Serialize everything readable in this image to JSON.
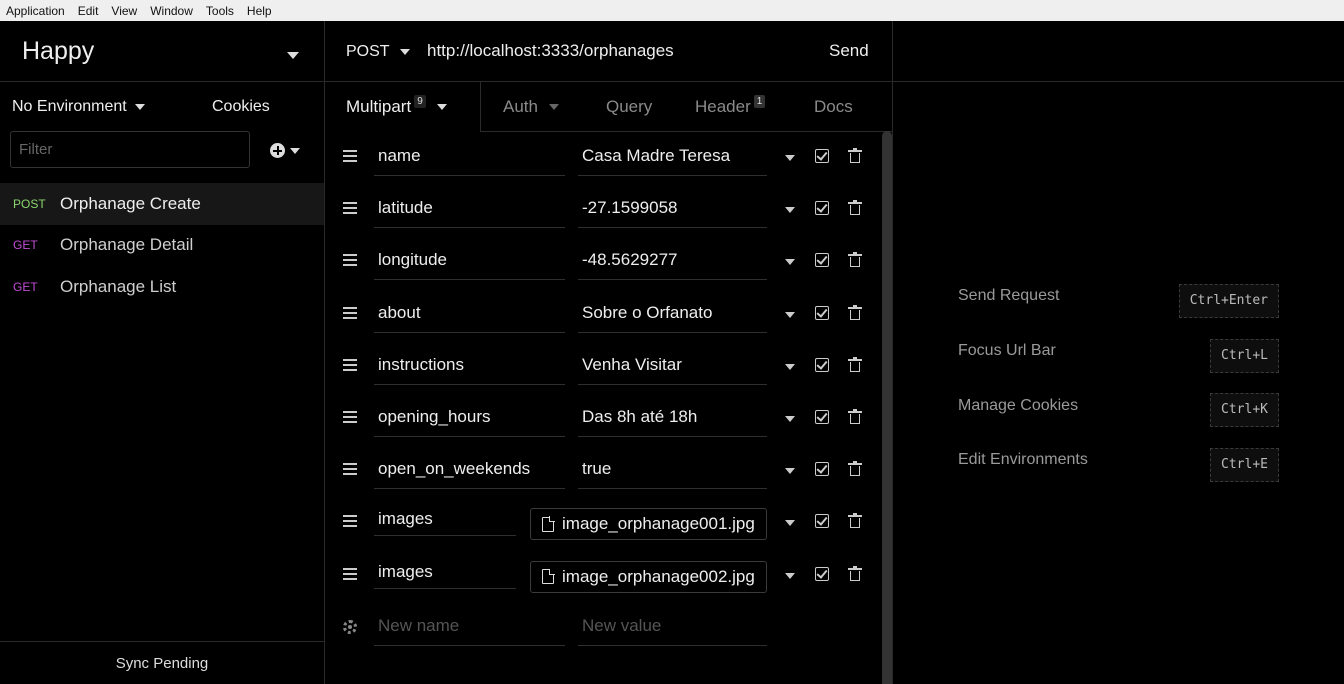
{
  "menu": [
    "Application",
    "Edit",
    "View",
    "Window",
    "Tools",
    "Help"
  ],
  "sidebar": {
    "workspace": "Happy",
    "environment": "No Environment",
    "cookies": "Cookies",
    "filter_placeholder": "Filter",
    "requests": [
      {
        "method": "POST",
        "name": "Orphanage Create"
      },
      {
        "method": "GET",
        "name": "Orphanage Detail"
      },
      {
        "method": "GET",
        "name": "Orphanage List"
      }
    ],
    "sync": "Sync Pending"
  },
  "request": {
    "method": "POST",
    "url": "http://localhost:3333/orphanages",
    "send": "Send",
    "tabs": [
      {
        "label": "Multipart",
        "badge": "9"
      },
      {
        "label": "Auth"
      },
      {
        "label": "Query"
      },
      {
        "label": "Header",
        "badge": "1"
      },
      {
        "label": "Docs"
      }
    ],
    "fields": [
      {
        "name": "name",
        "value": "Casa Madre Teresa"
      },
      {
        "name": "latitude",
        "value": "-27.1599058"
      },
      {
        "name": "longitude",
        "value": "-48.5629277"
      },
      {
        "name": "about",
        "value": "Sobre o Orfanato"
      },
      {
        "name": "instructions",
        "value": "Venha Visitar"
      },
      {
        "name": "opening_hours",
        "value": "Das 8h até 18h"
      },
      {
        "name": "open_on_weekends",
        "value": "true"
      },
      {
        "name": "images",
        "file": "image_orphanage001.jpg"
      },
      {
        "name": "images",
        "file": "image_orphanage002.jpg"
      }
    ],
    "new_name_placeholder": "New name",
    "new_value_placeholder": "New value"
  },
  "response": {
    "shortcuts": [
      {
        "label": "Send Request",
        "keys": "Ctrl+Enter"
      },
      {
        "label": "Focus Url Bar",
        "keys": "Ctrl+L"
      },
      {
        "label": "Manage Cookies",
        "keys": "Ctrl+K"
      },
      {
        "label": "Edit Environments",
        "keys": "Ctrl+E"
      }
    ]
  }
}
